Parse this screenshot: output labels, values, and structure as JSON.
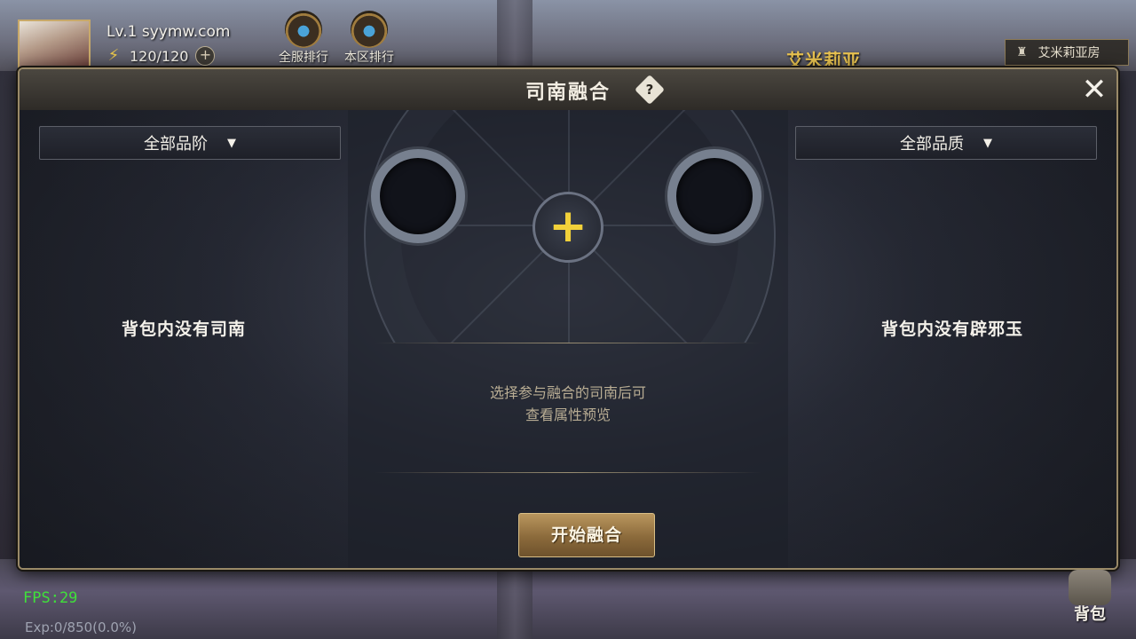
{
  "hud": {
    "level": "Lv.1",
    "player_name": "syymw.com",
    "energy": "120/120",
    "energy_plus": "+",
    "rank_server": "全服排行",
    "rank_region": "本区排行",
    "map_name": "艾米莉亚",
    "location": "艾米莉亚房"
  },
  "dialog": {
    "title": "司南融合",
    "help": "?",
    "close": "✕"
  },
  "left_panel": {
    "filter": "全部品阶",
    "empty_message": "背包内没有司南"
  },
  "right_panel": {
    "filter": "全部品质",
    "empty_message": "背包内没有辟邪玉"
  },
  "center_panel": {
    "add_symbol": "+",
    "hint_line1": "选择参与融合的司南后可",
    "hint_line2": "查看属性预览",
    "start_button": "开始融合"
  },
  "bottom_hud": {
    "fps": "FPS:29",
    "exp": "Exp:0/850(0.0%)",
    "bag": "背包"
  },
  "colors": {
    "accent_gold": "#e8c250",
    "plus_yellow": "#f2d13a",
    "fps_green": "#3fe03a"
  }
}
